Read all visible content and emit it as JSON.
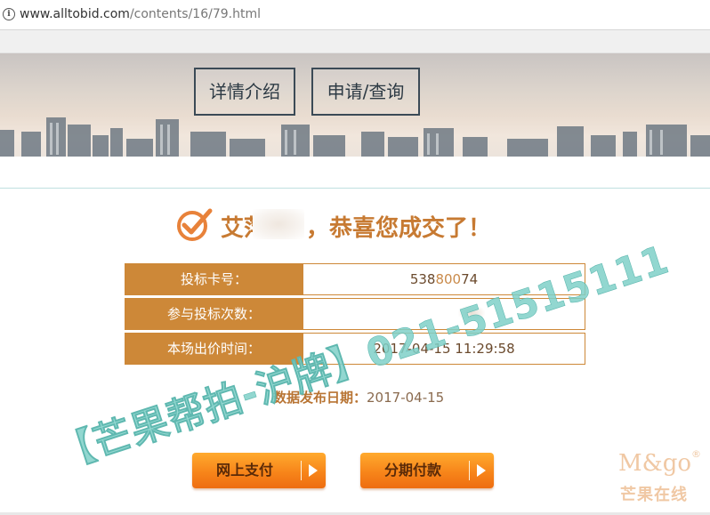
{
  "browser": {
    "url_host": "www.alltobid.com",
    "url_path": "/contents/16/79.html"
  },
  "nav": {
    "details_label": "详情介绍",
    "apply_label": "申请/查询"
  },
  "result": {
    "name_visible": "艾萍",
    "message": "，恭喜您成交了！"
  },
  "table": [
    {
      "label": "投标卡号：",
      "value_start": "538",
      "value_blur": "800",
      "value_end": "74"
    },
    {
      "label": "参与投标次数：",
      "value": ""
    },
    {
      "label": "本场出价时间：",
      "value": "2017-04-15 11:29:58"
    }
  ],
  "publish": {
    "label": "数据发布日期：",
    "date": "2017-04-15"
  },
  "buttons": {
    "online_pay": "网上支付",
    "installment": "分期付款"
  },
  "watermark": {
    "text": "【芒果帮拍-沪牌】021-51515111"
  },
  "logo": {
    "line1": "M&go",
    "reg": "®",
    "line2": "芒果在线"
  },
  "colors": {
    "accent": "#cd8838",
    "headline": "#c77a32",
    "watermark": "#7fd0c8",
    "button": "#f7851a"
  }
}
